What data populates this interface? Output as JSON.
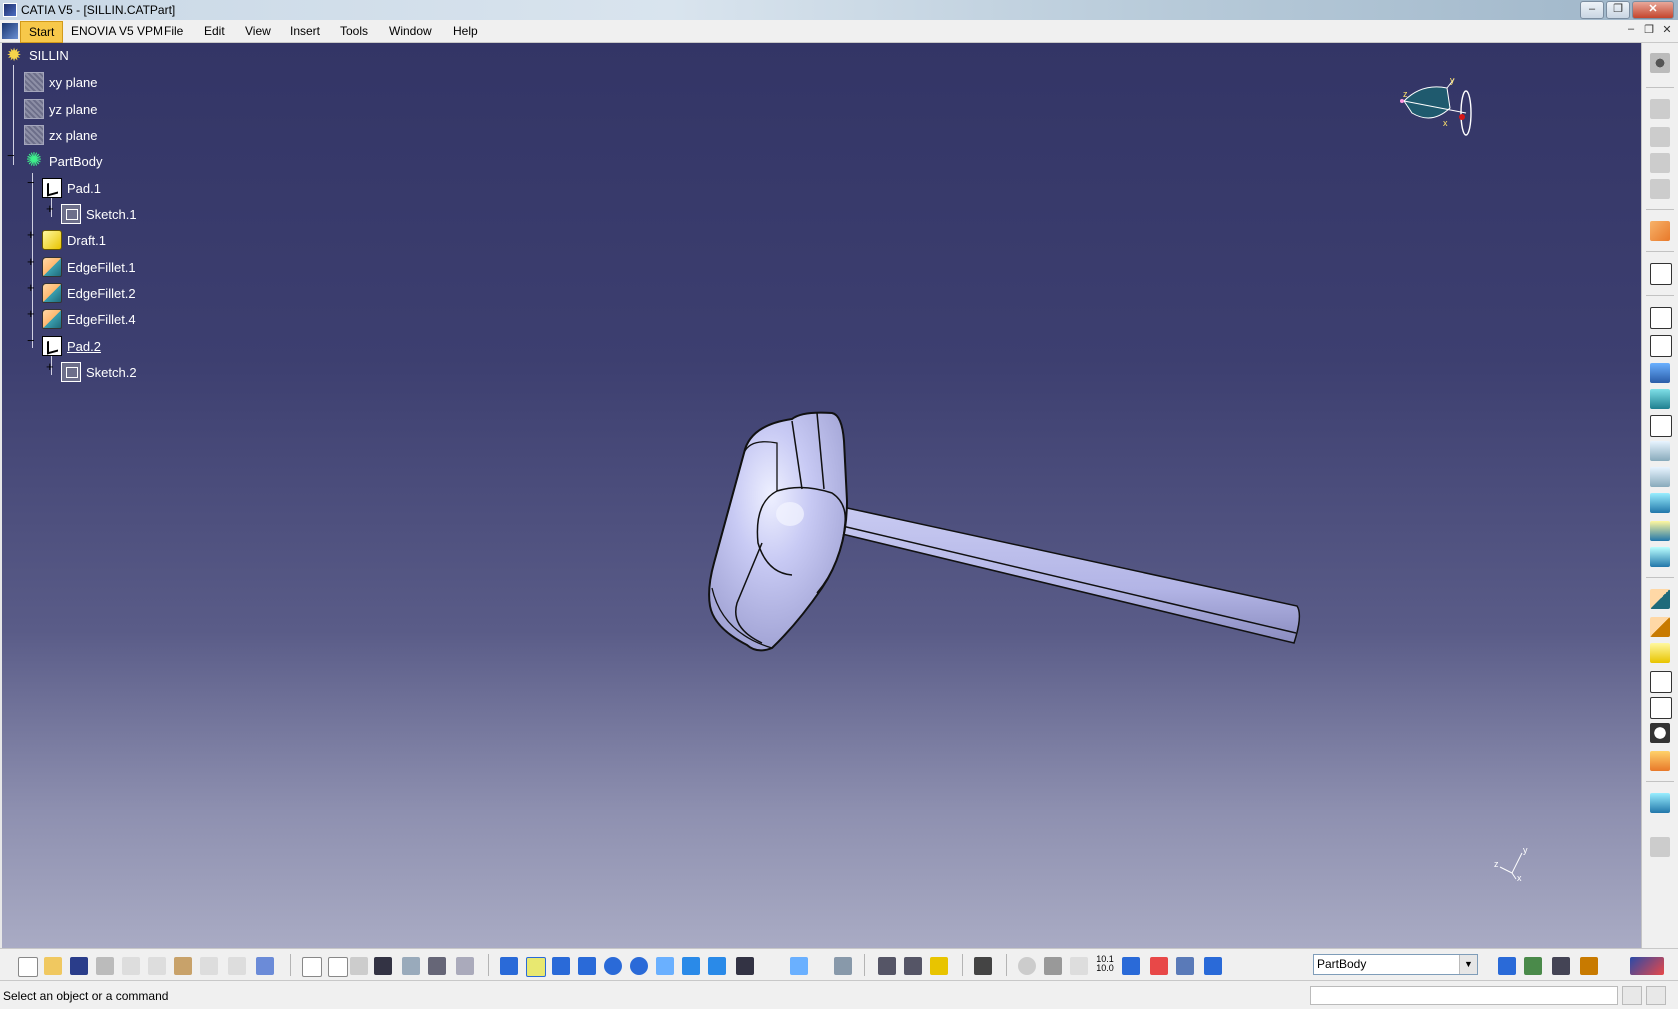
{
  "window": {
    "title": "CATIA V5 - [SILLIN.CATPart]",
    "buttons": [
      "–",
      "❐",
      "✕"
    ]
  },
  "menubar": {
    "items": [
      "Start",
      "ENOVIA V5 VPM",
      "File",
      "Edit",
      "View",
      "Insert",
      "Tools",
      "Window",
      "Help"
    ],
    "mdi_buttons": [
      "–",
      "❐",
      "✕"
    ]
  },
  "tree": {
    "root": "SILLIN",
    "planes": [
      "xy plane",
      "yz plane",
      "zx plane"
    ],
    "body": "PartBody",
    "features": {
      "pad1": "Pad.1",
      "sketch1": "Sketch.1",
      "draft1": "Draft.1",
      "fillet1": "EdgeFillet.1",
      "fillet2": "EdgeFillet.2",
      "fillet4": "EdgeFillet.4",
      "pad2": "Pad.2",
      "sketch2": "Sketch.2"
    }
  },
  "compass": {
    "labels": [
      "z",
      "y",
      "x"
    ]
  },
  "mini_axis": {
    "labels": [
      "y",
      "z",
      "x"
    ]
  },
  "toolbar": {
    "current_body": "PartBody",
    "zoom_label_top": "10.1",
    "zoom_label_bottom": "10.0"
  },
  "status": {
    "message": "Select an object or a command"
  },
  "colors": {
    "viewport_top": "#333566",
    "viewport_bottom": "#a9abc4",
    "part": "#b9bbef",
    "start_menu": "#f7c84a"
  }
}
